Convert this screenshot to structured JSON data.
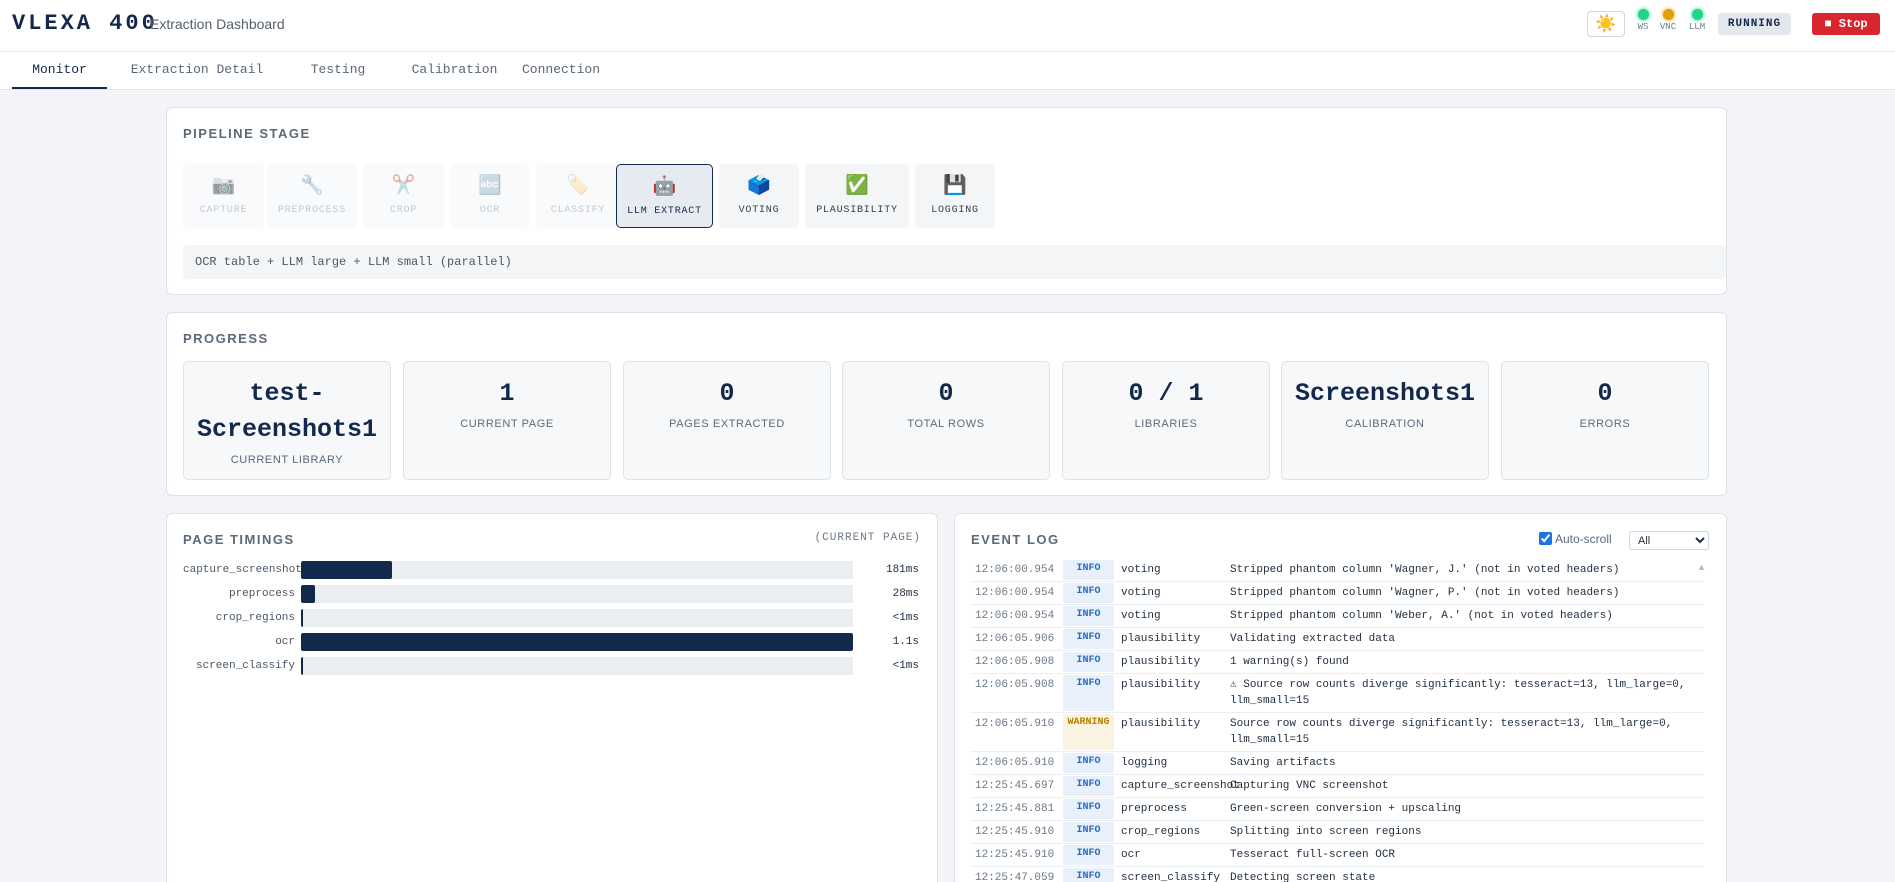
{
  "header": {
    "brand": "VLEXA 400",
    "subtitle": "Extraction Dashboard",
    "theme_icon": "☀️",
    "indicators": [
      {
        "label": "WS",
        "color": "#22d38a"
      },
      {
        "label": "VNC",
        "color": "#e0a100"
      },
      {
        "label": "LLM",
        "color": "#22d38a"
      }
    ],
    "status": "RUNNING",
    "stop_label": "■ Stop"
  },
  "tabs": [
    {
      "label": "Monitor",
      "active": true
    },
    {
      "label": "Extraction Detail",
      "active": false
    },
    {
      "label": "Testing",
      "active": false
    },
    {
      "label": "Calibration",
      "active": false
    },
    {
      "label": "Connection",
      "active": false
    }
  ],
  "pipeline": {
    "title": "PIPELINE STAGE",
    "stages": [
      {
        "label": "CAPTURE",
        "icon": "📷",
        "icon_name": "camera-icon",
        "state": "done"
      },
      {
        "label": "PREPROCESS",
        "icon": "🔧",
        "icon_name": "wrench-icon",
        "state": "done"
      },
      {
        "label": "CROP",
        "icon": "✂️",
        "icon_name": "scissors-icon",
        "state": "done"
      },
      {
        "label": "OCR",
        "icon": "🔤",
        "icon_name": "abc-icon",
        "state": "done"
      },
      {
        "label": "CLASSIFY",
        "icon": "🏷️",
        "icon_name": "tag-icon",
        "state": "done"
      },
      {
        "label": "LLM EXTRACT",
        "icon": "🤖",
        "icon_name": "robot-icon",
        "state": "active"
      },
      {
        "label": "VOTING",
        "icon": "🗳️",
        "icon_name": "ballot-box-icon",
        "state": "pending"
      },
      {
        "label": "PLAUSIBILITY",
        "icon": "✅",
        "icon_name": "check-icon",
        "state": "pending"
      },
      {
        "label": "LOGGING",
        "icon": "💾",
        "icon_name": "floppy-disk-icon",
        "state": "pending"
      }
    ],
    "description": "OCR table + LLM large + LLM small (parallel)"
  },
  "progress": {
    "title": "PROGRESS",
    "cards": [
      {
        "value": "test-Screenshots1",
        "label": "CURRENT LIBRARY"
      },
      {
        "value": "1",
        "label": "CURRENT PAGE"
      },
      {
        "value": "0",
        "label": "PAGES EXTRACTED"
      },
      {
        "value": "0",
        "label": "TOTAL ROWS"
      },
      {
        "value": "0 / 1",
        "label": "LIBRARIES"
      },
      {
        "value": "Screenshots1",
        "label": "CALIBRATION"
      },
      {
        "value": "0",
        "label": "ERRORS"
      }
    ]
  },
  "timings": {
    "title": "PAGE TIMINGS",
    "subtitle": "(CURRENT PAGE)",
    "rows": [
      {
        "name": "capture_screenshot",
        "ms": 181,
        "display": "181ms"
      },
      {
        "name": "preprocess",
        "ms": 28,
        "display": "28ms"
      },
      {
        "name": "crop_regions",
        "ms": 0.5,
        "display": "<1ms"
      },
      {
        "name": "ocr",
        "ms": 1100,
        "display": "1.1s"
      },
      {
        "name": "screen_classify",
        "ms": 0.5,
        "display": "<1ms"
      }
    ]
  },
  "event_log": {
    "title": "EVENT LOG",
    "autoscroll_label": "Auto-scroll",
    "autoscroll_checked": true,
    "filter_value": "All",
    "entries": [
      {
        "time": "12:06:00.954",
        "level": "INFO",
        "stage": "voting",
        "message": "Stripped phantom column 'Wagner, J.' (not in voted headers)"
      },
      {
        "time": "12:06:00.954",
        "level": "INFO",
        "stage": "voting",
        "message": "Stripped phantom column 'Wagner, P.' (not in voted headers)"
      },
      {
        "time": "12:06:00.954",
        "level": "INFO",
        "stage": "voting",
        "message": "Stripped phantom column 'Weber, A.' (not in voted headers)"
      },
      {
        "time": "12:06:05.906",
        "level": "INFO",
        "stage": "plausibility",
        "message": "Validating extracted data"
      },
      {
        "time": "12:06:05.908",
        "level": "INFO",
        "stage": "plausibility",
        "message": "1 warning(s) found"
      },
      {
        "time": "12:06:05.908",
        "level": "INFO",
        "stage": "plausibility",
        "message": "⚠ Source row counts diverge significantly: tesseract=13, llm_large=0, llm_small=15"
      },
      {
        "time": "12:06:05.910",
        "level": "WARNING",
        "stage": "plausibility",
        "message": "Source row counts diverge significantly: tesseract=13, llm_large=0, llm_small=15"
      },
      {
        "time": "12:06:05.910",
        "level": "INFO",
        "stage": "logging",
        "message": "Saving artifacts"
      },
      {
        "time": "12:25:45.697",
        "level": "INFO",
        "stage": "capture_screenshot",
        "message": "Capturing VNC screenshot"
      },
      {
        "time": "12:25:45.881",
        "level": "INFO",
        "stage": "preprocess",
        "message": "Green-screen conversion + upscaling"
      },
      {
        "time": "12:25:45.910",
        "level": "INFO",
        "stage": "crop_regions",
        "message": "Splitting into screen regions"
      },
      {
        "time": "12:25:45.910",
        "level": "INFO",
        "stage": "ocr",
        "message": "Tesseract full-screen OCR"
      },
      {
        "time": "12:25:47.059",
        "level": "INFO",
        "stage": "screen_classify",
        "message": "Detecting screen state"
      }
    ]
  }
}
